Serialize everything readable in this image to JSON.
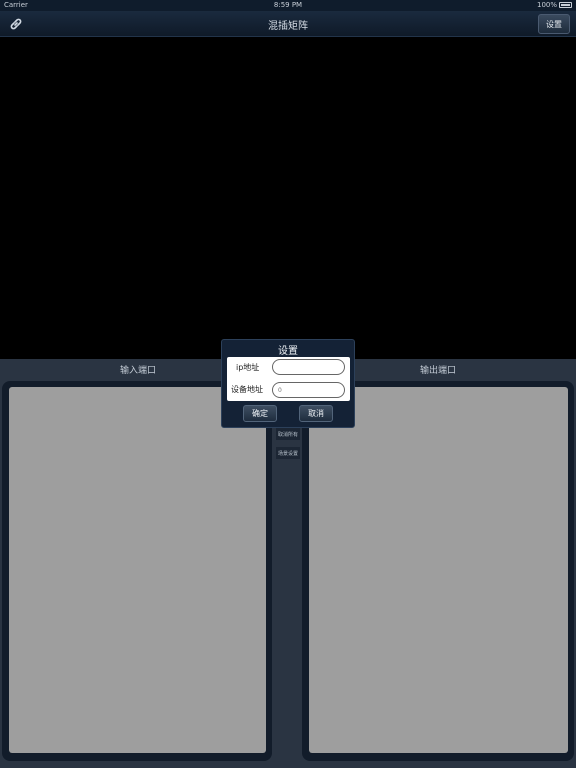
{
  "status_bar": {
    "carrier": "Carrier",
    "time": "8:59 PM",
    "battery": "100%"
  },
  "nav": {
    "title": "混插矩阵",
    "settings_label": "设置",
    "link_icon": "link-icon"
  },
  "ports": {
    "input_label": "输入端口",
    "output_label": "输出端口",
    "cancel_all_label": "取消所有",
    "scene_settings_label": "场景设置"
  },
  "dialog": {
    "title": "设置",
    "ip_label": "ip地址",
    "ip_value": "",
    "device_label": "设备地址",
    "device_placeholder": "0",
    "confirm_label": "确定",
    "cancel_label": "取消"
  },
  "colors": {
    "accent": "#142236",
    "panel": "#9e9e9e",
    "background": "#2a3442"
  }
}
